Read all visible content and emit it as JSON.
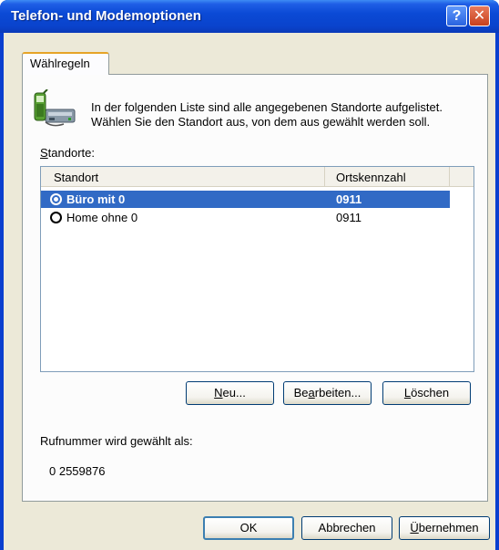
{
  "window": {
    "title": "Telefon- und Modemoptionen",
    "help_glyph": "?",
    "close_glyph": "✕"
  },
  "tabs": [
    {
      "label": "Wählregeln"
    }
  ],
  "info": {
    "icon": "phone-modem-icon",
    "line1": "In der folgenden Liste sind alle angegebenen Standorte aufgelistet.",
    "line2": "Wählen Sie den Standort aus, von dem aus gewählt werden soll."
  },
  "locations": {
    "label_prefix": "S",
    "label_rest": "tandorte:",
    "columns": [
      "Standort",
      "Ortskennzahl"
    ],
    "rows": [
      {
        "name": "Büro mit 0",
        "code": "0911",
        "selected": true
      },
      {
        "name": "Home ohne 0",
        "code": "0911",
        "selected": false
      }
    ]
  },
  "list_buttons": {
    "new_u": "N",
    "new_rest": "eu...",
    "edit_pre": "Be",
    "edit_u": "a",
    "edit_rest": "rbeiten...",
    "delete_u": "L",
    "delete_rest": "öschen"
  },
  "dial": {
    "label": "Rufnummer wird gewählt als:",
    "number": "0 2559876"
  },
  "dialog_buttons": {
    "ok": "OK",
    "cancel": "Abbrechen",
    "apply_u": "Ü",
    "apply_rest": "bernehmen"
  },
  "colors": {
    "title_bar": "#0a43cc",
    "selection": "#316ac5",
    "face": "#ece9d8"
  }
}
